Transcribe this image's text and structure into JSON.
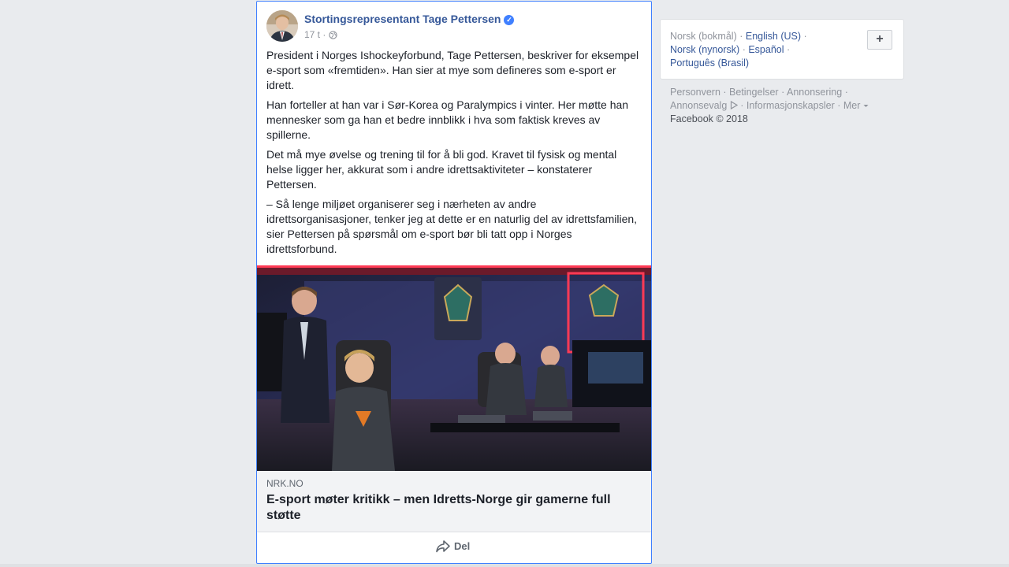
{
  "post": {
    "author": "Stortingsrepresentant Tage Pettersen",
    "verified_icon": "verified-check-icon",
    "time": "17 t",
    "separator": "·",
    "privacy_icon": "globe-icon",
    "paragraphs": [
      "President i Norges Ishockeyforbund, Tage Pettersen, beskriver for eksempel e-sport som «fremtiden». Han sier at mye som defineres som e-sport er idrett.",
      "Han forteller at han var i Sør-Korea og Paralympics i vinter. Her møtte han mennesker som ga han et bedre innblikk i hva som faktisk kreves av spillerne.",
      "Det må mye øvelse og trening til for å bli god. Kravet til fysisk og mental helse ligger her, akkurat som i andre idrettsaktiviteter – konstaterer Pettersen.",
      "– Så lenge miljøet organiserer seg i nærheten av andre idrettsorganisasjoner, tenker jeg at dette er en naturlig del av idrettsfamilien, sier Pettersen på spørsmål om e-sport bør bli tatt opp i Norges idrettsforbund."
    ],
    "link": {
      "domain": "NRK.NO",
      "title": "E-sport møter kritikk – men Idretts-Norge gir gamerne full støtte"
    },
    "actions": {
      "share_label": "Del",
      "share_icon": "share-arrow-icon"
    }
  },
  "sidebar": {
    "languages": [
      {
        "label": "Norsk (bokmål)",
        "current": true
      },
      {
        "label": "English (US)",
        "current": false
      },
      {
        "label": "Norsk (nynorsk)",
        "current": false
      },
      {
        "label": "Español",
        "current": false
      },
      {
        "label": "Português (Brasil)",
        "current": false
      }
    ],
    "add_language_label": "+",
    "footer": {
      "links": [
        "Personvern",
        "Betingelser",
        "Annonsering",
        "Annonsevalg",
        "Informasjonskapsler",
        "Mer"
      ],
      "more_icon": "caret-down-icon",
      "adchoices_icon": "adchoices-icon",
      "copyright": "Facebook © 2018"
    }
  },
  "colors": {
    "background": "#e9ebee",
    "link_blue": "#365899",
    "focus_border": "#4080ff",
    "muted_text": "#90949c"
  }
}
